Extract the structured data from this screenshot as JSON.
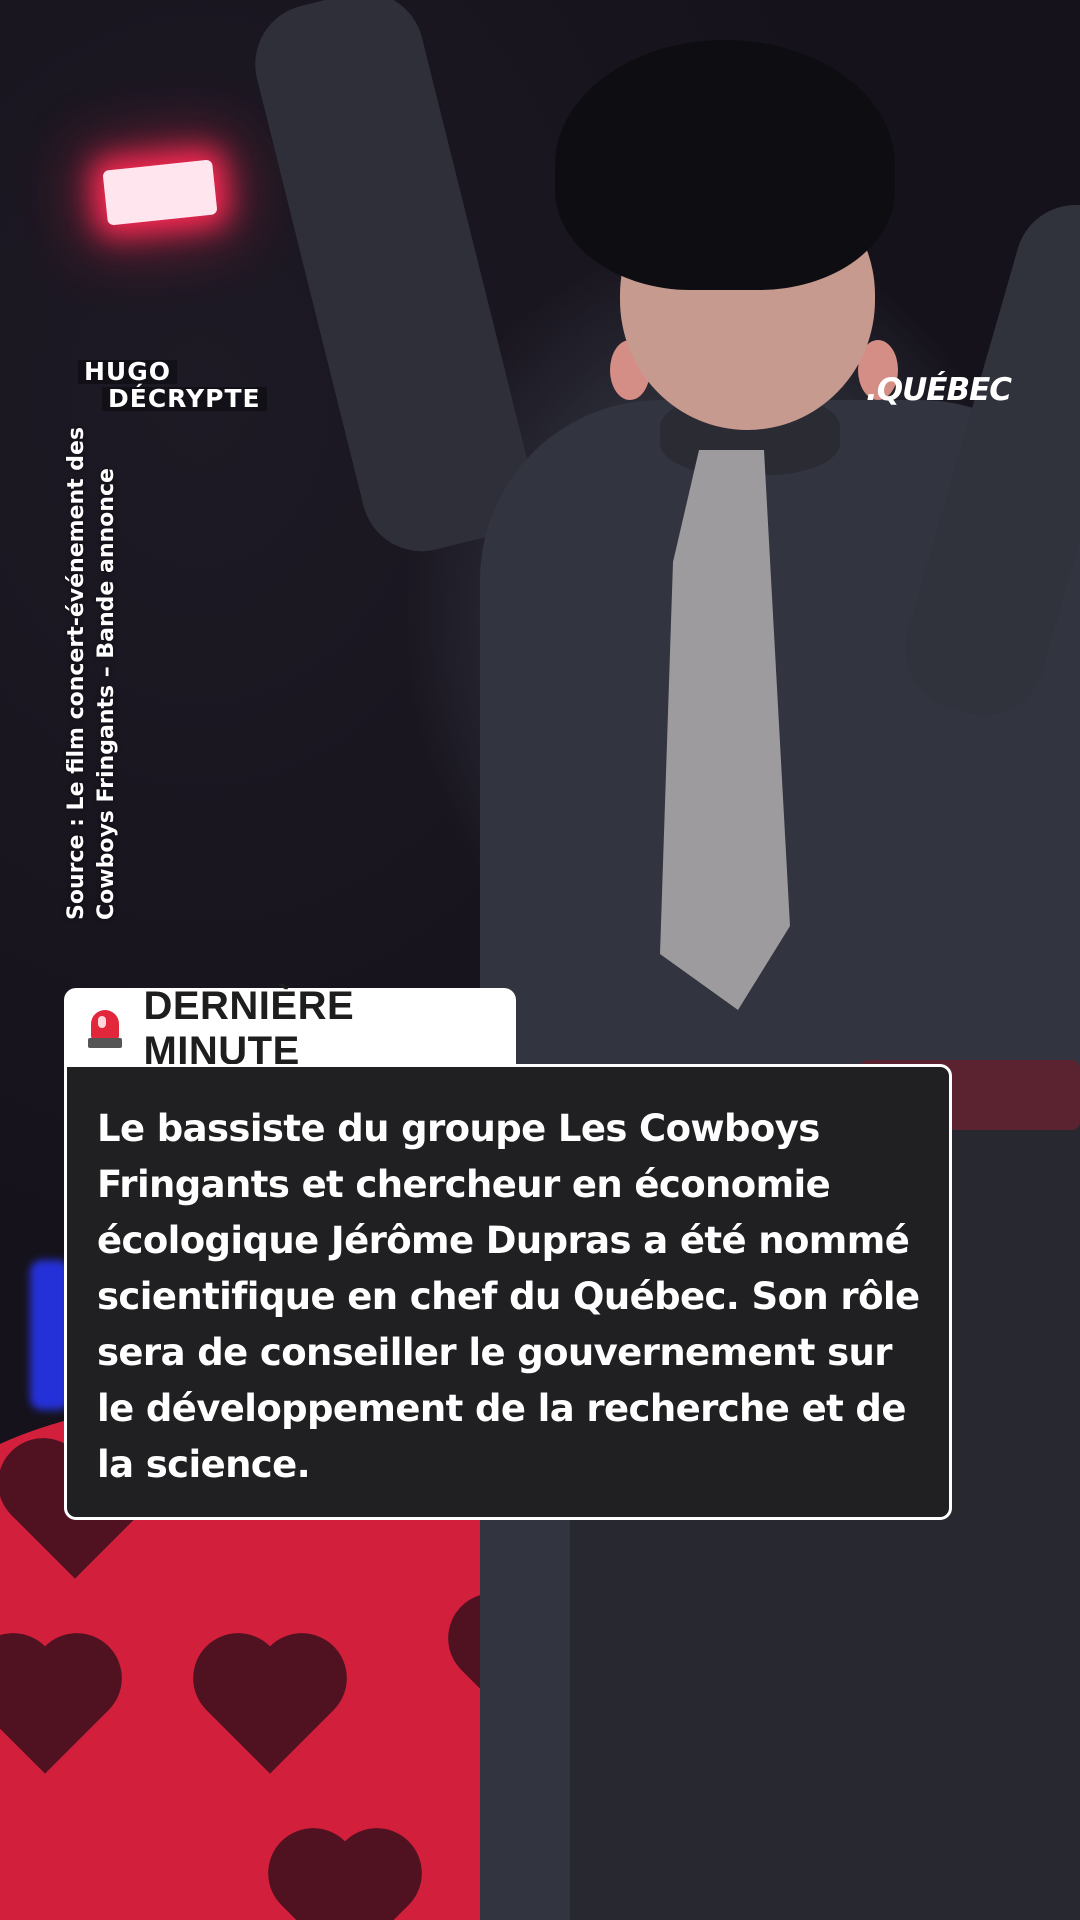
{
  "watermark": {
    "line1": "HUGO",
    "line2": "DÉCRYPTE"
  },
  "location_tag": ".QUÉBEC",
  "source": {
    "line1": "Source : Le film concert-événement des",
    "line2": "Cowboys Fringants – Bande annonce"
  },
  "breaking": {
    "icon": "siren-icon",
    "label": "DERNIÈRE MINUTE",
    "accent": "#e2263b"
  },
  "news": {
    "body": "Le bassiste du groupe Les Cowboys Fringants et chercheur en économie écologique Jérôme Dupras a été nommé scientifique en chef du Québec. Son rôle sera de conseiller le gouvernement sur le développement de la recherche et de la science."
  }
}
